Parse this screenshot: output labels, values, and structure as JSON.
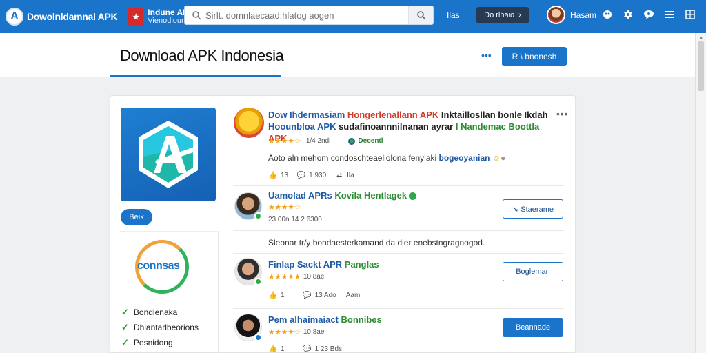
{
  "topbar": {
    "brand_logo": "A",
    "brand_name": "Dowolnldamnal APK",
    "site_flag": "★",
    "site_title": "Indune APK",
    "site_subtitle": "Vienodiouran",
    "search_placeholder": "Sirlt. domnlaecaad:hlatog aogen",
    "nav_link": "Ilas",
    "lang_button": "Do rlhaio",
    "user_name": "Hasam"
  },
  "header": {
    "title": "Download APK Indonesia",
    "more": "•••",
    "button": "R \\ bnonesh"
  },
  "app": {
    "icon_letter": "A",
    "pill_button": "Beik"
  },
  "side": {
    "logo_text": "connsas",
    "checks": [
      "Bondlenaka",
      "Dhlantarlbeorions",
      "Pesnidong"
    ]
  },
  "post1": {
    "title_a": "Dow Ihdermasiam ",
    "title_b": "Hongerlenallann APK ",
    "title_c": "Inktaillosllan bonle Ikdah",
    "title_d": "Hoounbloa APK ",
    "title_e": "sudafinoannnilnanan ayrar ",
    "title_f": "I Nandemac Boottla ",
    "title_g": "APK",
    "stars": "★★★★☆",
    "rating": "1/4 2ndi",
    "badge": "Decentl",
    "text": "Aoto aln mehom condoschteaeliolona fenylaki ",
    "text_hl": "bogeoyanian",
    "likes": "13",
    "comments": "1 930",
    "shares": "Ila"
  },
  "post2": {
    "name_a": "Uamolad APRs ",
    "name_b": "Kovila Hentlagek",
    "stars": "★★★★☆",
    "meta": "23 00n  14 2 6300",
    "button": "➘ Staerame",
    "text": "Sleonar tr/y  bondaesterkamand da dier enebstngragnogod."
  },
  "post3": {
    "name_a": "Finlap Sackt APR ",
    "name_b": "Panglas",
    "stars": "★★★★★",
    "rating": "10 8ae",
    "likes": "1",
    "comments": "13 Ado",
    "shares": "Aam",
    "button": "Bogleman"
  },
  "post4": {
    "name_a": "Pem alhaimaiact ",
    "name_b": "Bonnibes",
    "stars": "★★★★☆",
    "rating": "10 8ae",
    "likes": "1",
    "comments": "1 23 Bds",
    "button": "Beannade"
  },
  "colors": {
    "primary": "#1a74c9",
    "dark": "#263a52",
    "star": "#f0a31b",
    "green": "#2a9d3a",
    "red": "#d23a2a"
  }
}
